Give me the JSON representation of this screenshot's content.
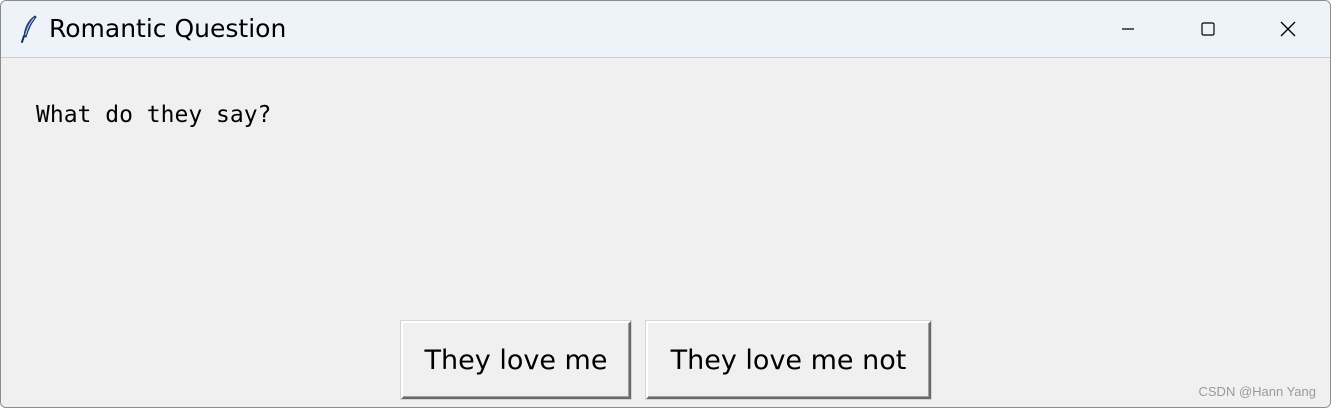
{
  "window": {
    "title": "Romantic Question",
    "title_icon": "feather-icon",
    "controls": {
      "minimize_icon": "minimize-icon",
      "maximize_icon": "maximize-icon",
      "close_icon": "close-icon"
    }
  },
  "content": {
    "question": "What do they say?",
    "buttons": {
      "love_label": "They love me",
      "love_not_label": "They love me not"
    }
  },
  "watermark": "CSDN @Hann Yang",
  "colors": {
    "titlebar_bg": "#eef3f9",
    "client_bg": "#f0f0f0",
    "text": "#000000",
    "watermark": "#9a9a9a"
  }
}
